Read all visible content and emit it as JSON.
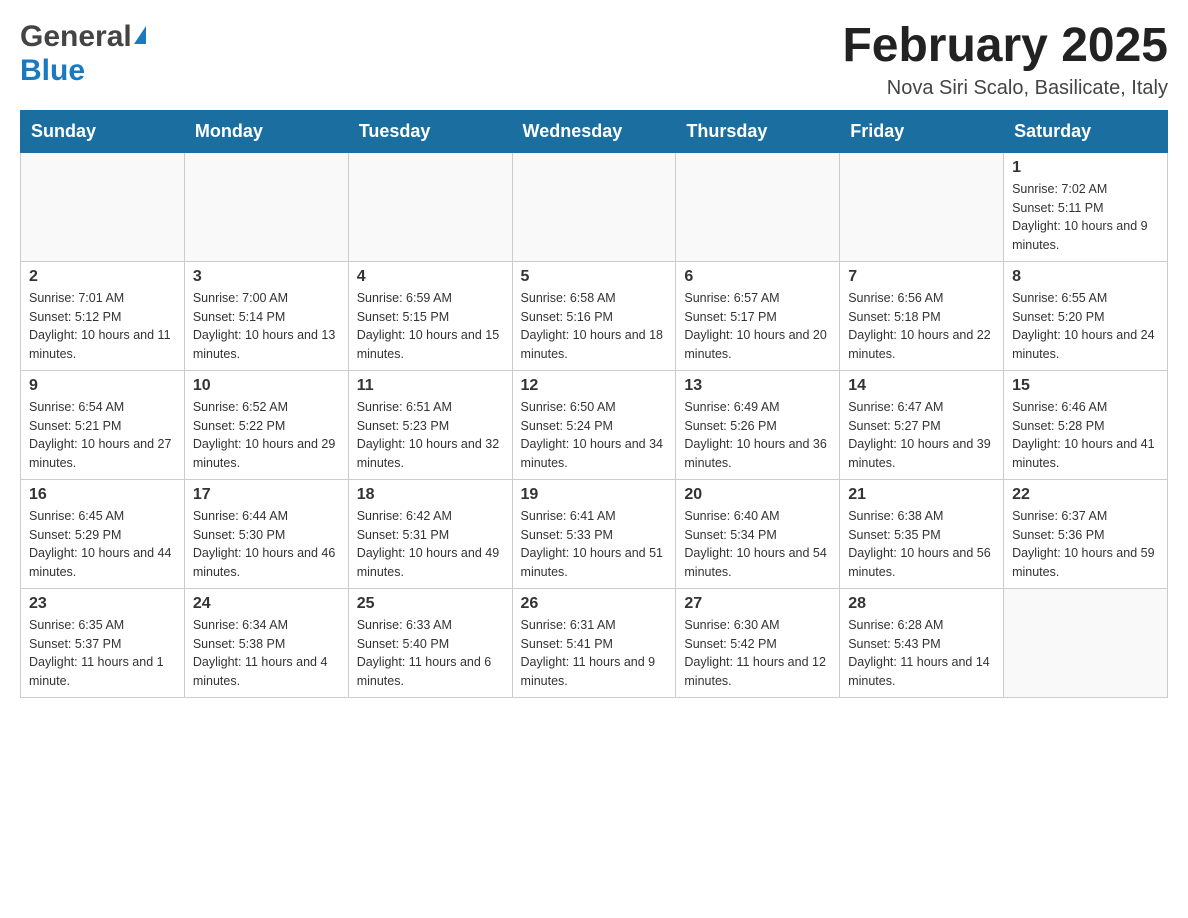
{
  "header": {
    "logo_general": "General",
    "logo_blue": "Blue",
    "month_title": "February 2025",
    "location": "Nova Siri Scalo, Basilicate, Italy"
  },
  "days_of_week": [
    "Sunday",
    "Monday",
    "Tuesday",
    "Wednesday",
    "Thursday",
    "Friday",
    "Saturday"
  ],
  "weeks": [
    [
      {
        "day": "",
        "info": ""
      },
      {
        "day": "",
        "info": ""
      },
      {
        "day": "",
        "info": ""
      },
      {
        "day": "",
        "info": ""
      },
      {
        "day": "",
        "info": ""
      },
      {
        "day": "",
        "info": ""
      },
      {
        "day": "1",
        "info": "Sunrise: 7:02 AM\nSunset: 5:11 PM\nDaylight: 10 hours and 9 minutes."
      }
    ],
    [
      {
        "day": "2",
        "info": "Sunrise: 7:01 AM\nSunset: 5:12 PM\nDaylight: 10 hours and 11 minutes."
      },
      {
        "day": "3",
        "info": "Sunrise: 7:00 AM\nSunset: 5:14 PM\nDaylight: 10 hours and 13 minutes."
      },
      {
        "day": "4",
        "info": "Sunrise: 6:59 AM\nSunset: 5:15 PM\nDaylight: 10 hours and 15 minutes."
      },
      {
        "day": "5",
        "info": "Sunrise: 6:58 AM\nSunset: 5:16 PM\nDaylight: 10 hours and 18 minutes."
      },
      {
        "day": "6",
        "info": "Sunrise: 6:57 AM\nSunset: 5:17 PM\nDaylight: 10 hours and 20 minutes."
      },
      {
        "day": "7",
        "info": "Sunrise: 6:56 AM\nSunset: 5:18 PM\nDaylight: 10 hours and 22 minutes."
      },
      {
        "day": "8",
        "info": "Sunrise: 6:55 AM\nSunset: 5:20 PM\nDaylight: 10 hours and 24 minutes."
      }
    ],
    [
      {
        "day": "9",
        "info": "Sunrise: 6:54 AM\nSunset: 5:21 PM\nDaylight: 10 hours and 27 minutes."
      },
      {
        "day": "10",
        "info": "Sunrise: 6:52 AM\nSunset: 5:22 PM\nDaylight: 10 hours and 29 minutes."
      },
      {
        "day": "11",
        "info": "Sunrise: 6:51 AM\nSunset: 5:23 PM\nDaylight: 10 hours and 32 minutes."
      },
      {
        "day": "12",
        "info": "Sunrise: 6:50 AM\nSunset: 5:24 PM\nDaylight: 10 hours and 34 minutes."
      },
      {
        "day": "13",
        "info": "Sunrise: 6:49 AM\nSunset: 5:26 PM\nDaylight: 10 hours and 36 minutes."
      },
      {
        "day": "14",
        "info": "Sunrise: 6:47 AM\nSunset: 5:27 PM\nDaylight: 10 hours and 39 minutes."
      },
      {
        "day": "15",
        "info": "Sunrise: 6:46 AM\nSunset: 5:28 PM\nDaylight: 10 hours and 41 minutes."
      }
    ],
    [
      {
        "day": "16",
        "info": "Sunrise: 6:45 AM\nSunset: 5:29 PM\nDaylight: 10 hours and 44 minutes."
      },
      {
        "day": "17",
        "info": "Sunrise: 6:44 AM\nSunset: 5:30 PM\nDaylight: 10 hours and 46 minutes."
      },
      {
        "day": "18",
        "info": "Sunrise: 6:42 AM\nSunset: 5:31 PM\nDaylight: 10 hours and 49 minutes."
      },
      {
        "day": "19",
        "info": "Sunrise: 6:41 AM\nSunset: 5:33 PM\nDaylight: 10 hours and 51 minutes."
      },
      {
        "day": "20",
        "info": "Sunrise: 6:40 AM\nSunset: 5:34 PM\nDaylight: 10 hours and 54 minutes."
      },
      {
        "day": "21",
        "info": "Sunrise: 6:38 AM\nSunset: 5:35 PM\nDaylight: 10 hours and 56 minutes."
      },
      {
        "day": "22",
        "info": "Sunrise: 6:37 AM\nSunset: 5:36 PM\nDaylight: 10 hours and 59 minutes."
      }
    ],
    [
      {
        "day": "23",
        "info": "Sunrise: 6:35 AM\nSunset: 5:37 PM\nDaylight: 11 hours and 1 minute."
      },
      {
        "day": "24",
        "info": "Sunrise: 6:34 AM\nSunset: 5:38 PM\nDaylight: 11 hours and 4 minutes."
      },
      {
        "day": "25",
        "info": "Sunrise: 6:33 AM\nSunset: 5:40 PM\nDaylight: 11 hours and 6 minutes."
      },
      {
        "day": "26",
        "info": "Sunrise: 6:31 AM\nSunset: 5:41 PM\nDaylight: 11 hours and 9 minutes."
      },
      {
        "day": "27",
        "info": "Sunrise: 6:30 AM\nSunset: 5:42 PM\nDaylight: 11 hours and 12 minutes."
      },
      {
        "day": "28",
        "info": "Sunrise: 6:28 AM\nSunset: 5:43 PM\nDaylight: 11 hours and 14 minutes."
      },
      {
        "day": "",
        "info": ""
      }
    ]
  ]
}
